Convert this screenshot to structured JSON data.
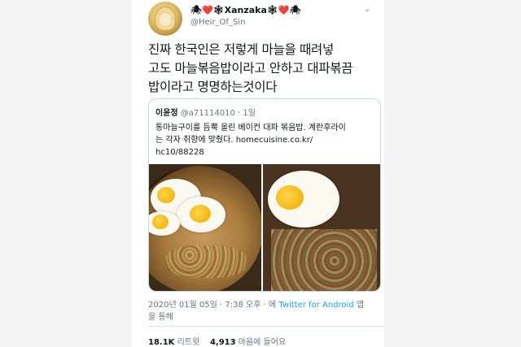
{
  "user": {
    "display_name": "🕷❤️🕸Xanzaka🕸❤️🕷",
    "handle": "@Heir_Of_Sin"
  },
  "tweet": {
    "lines": [
      "진짜 한국인은 저렇게 마늘을 때려넣",
      "고도 마늘볶음밥이라고 안하고 대파볶끔",
      "밥이라고 명명하는것이다"
    ]
  },
  "quote": {
    "name": "이윤정",
    "meta": "@a71114010 · 1일",
    "lines": [
      "통마늘구이를 듬뿍 올린 베이컨 대파 볶음밥. 계란후라이",
      "는 각자 취향에 맞췄다. homecuisine.co.kr/",
      "hc10/88228"
    ]
  },
  "timestamp": {
    "date_time": "2020년 01월 05일 · 7:38 오후 · 에",
    "source": "Twitter for Android",
    "suffix": "앱",
    "line2": "을 통해"
  },
  "stats": {
    "retweets_count": "18.1K",
    "retweets_label": "리트윗",
    "likes_count": "4,913",
    "likes_label": "마음에 들어요"
  }
}
